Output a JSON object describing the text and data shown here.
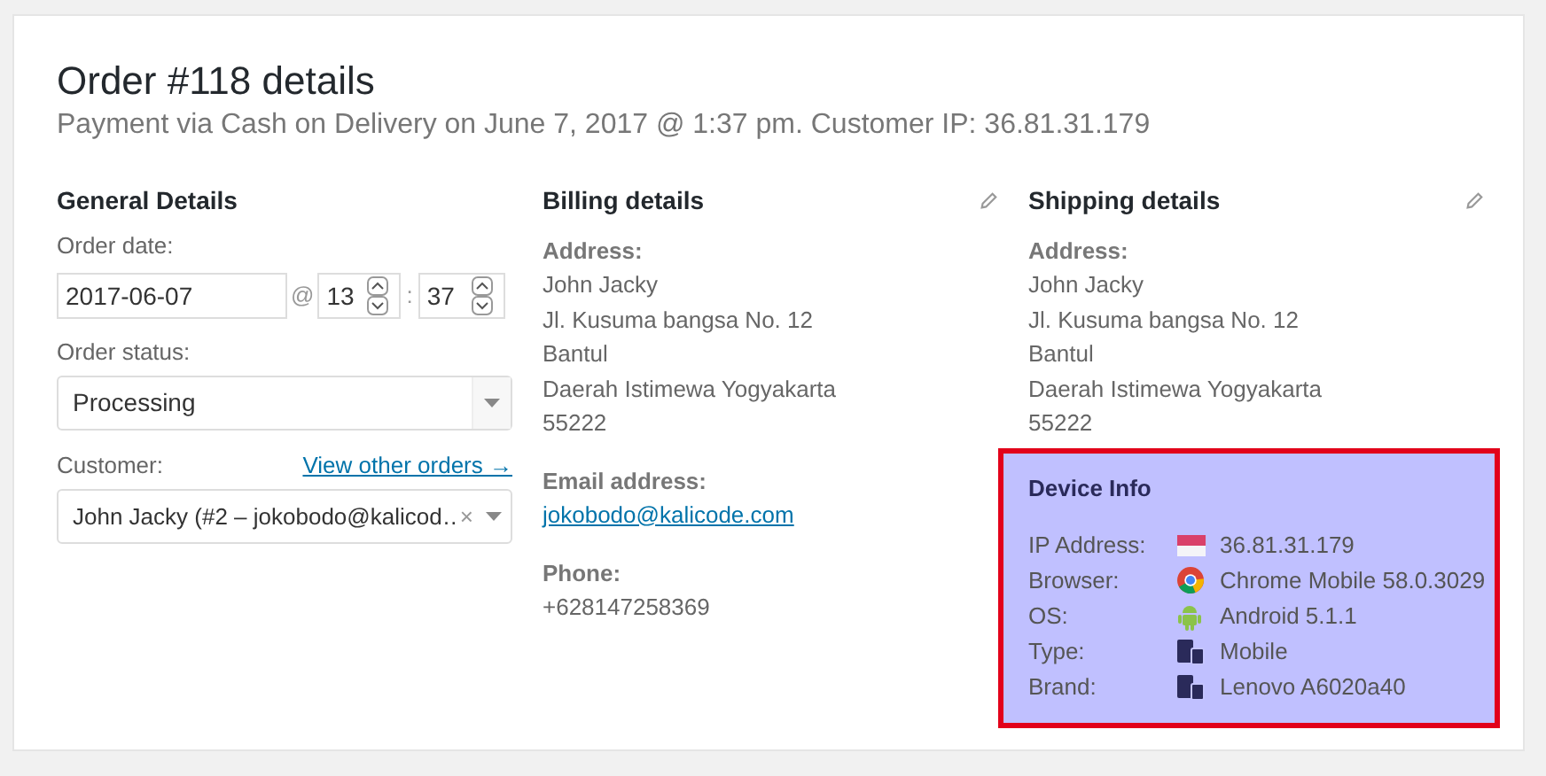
{
  "title": "Order #118 details",
  "subtitle": "Payment via Cash on Delivery on June 7, 2017 @ 1:37 pm. Customer IP: 36.81.31.179",
  "general": {
    "heading": "General Details",
    "date_label": "Order date:",
    "date_value": "2017-06-07",
    "at": "@",
    "hour": "13",
    "colon": ":",
    "minute": "37",
    "status_label": "Order status:",
    "status_value": "Processing",
    "customer_label": "Customer:",
    "customer_link": "View other orders →",
    "customer_value": "John Jacky (#2 – jokobodo@kalicod…",
    "clear": "×"
  },
  "billing": {
    "heading": "Billing details",
    "address_label": "Address:",
    "address": [
      "John Jacky",
      "Jl. Kusuma bangsa No. 12",
      "Bantul",
      "Daerah Istimewa Yogyakarta",
      "55222"
    ],
    "email_label": "Email address:",
    "email": "jokobodo@kalicode.com",
    "phone_label": "Phone:",
    "phone": "+628147258369"
  },
  "shipping": {
    "heading": "Shipping details",
    "address_label": "Address:",
    "address": [
      "John Jacky",
      "Jl. Kusuma bangsa No. 12",
      "Bantul",
      "Daerah Istimewa Yogyakarta",
      "55222"
    ]
  },
  "device_info": {
    "heading": "Device Info",
    "rows": [
      {
        "label": "IP Address:",
        "kind": "flag",
        "value": "36.81.31.179"
      },
      {
        "label": "Browser:",
        "kind": "browser",
        "value": "Chrome Mobile 58.0.3029"
      },
      {
        "label": "OS:",
        "kind": "android",
        "value": "Android 5.1.1"
      },
      {
        "label": "Type:",
        "kind": "device",
        "value": "Mobile"
      },
      {
        "label": "Brand:",
        "kind": "device",
        "value": "Lenovo A6020a40"
      }
    ]
  }
}
